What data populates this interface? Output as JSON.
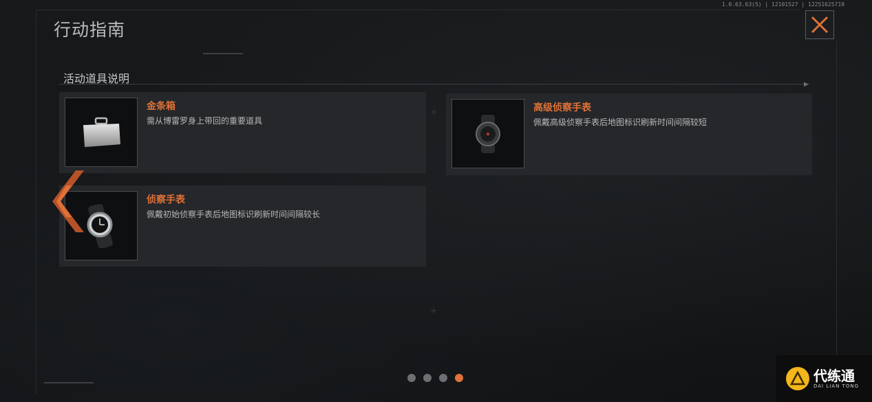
{
  "version": "1.0.63.63(5) | 12101527 | 12251625719",
  "title": "行动指南",
  "section_title": "活动道具说明",
  "items": [
    {
      "name": "金条箱",
      "desc": "需从博雷罗身上带回的重要道具",
      "icon": "briefcase-icon"
    },
    {
      "name": "高级侦察手表",
      "desc": "佩戴高级侦察手表后地图标识刷新时间间隔较短",
      "icon": "watch-icon"
    },
    {
      "name": "侦察手表",
      "desc": "佩戴初始侦察手表后地图标识刷新时间间隔较长",
      "icon": "watch-icon"
    }
  ],
  "pagination": {
    "total": 4,
    "active_index": 3
  },
  "logo": {
    "cn": "代练通",
    "en": "DAI LIAN TONG"
  },
  "colors": {
    "accent": "#e07238",
    "background": "#131517",
    "card": "#25272a"
  }
}
